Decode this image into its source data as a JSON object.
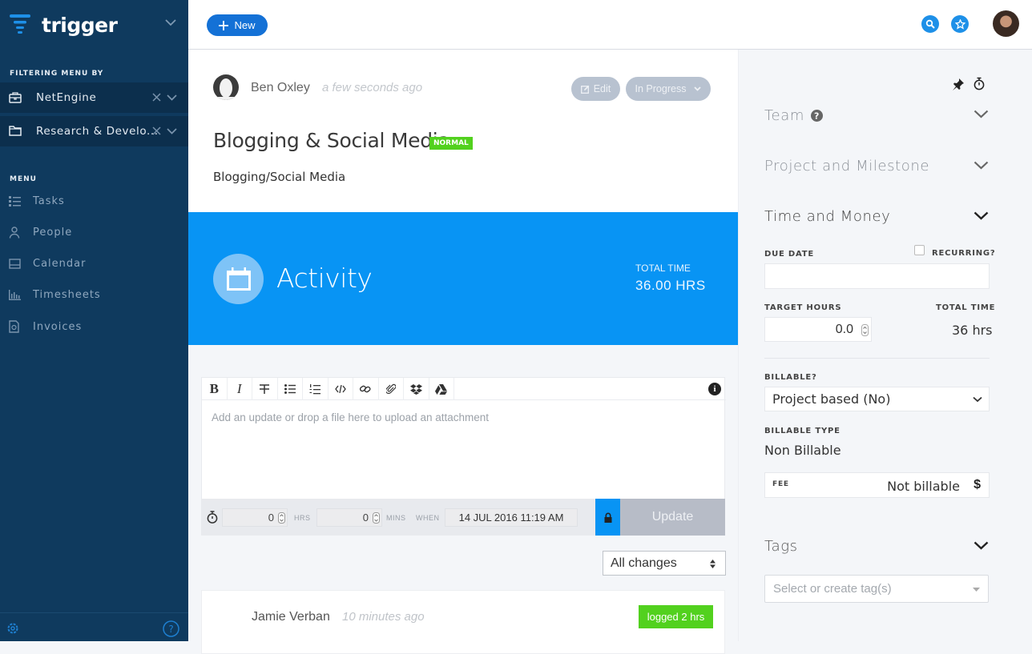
{
  "sidebar": {
    "brand": "trigger",
    "filter_heading": "FILTERING MENU BY",
    "filters": [
      {
        "icon": "briefcase-icon",
        "label": "NetEngine"
      },
      {
        "icon": "folder-icon",
        "label": "Research & Develo..."
      }
    ],
    "menu_heading": "MENU",
    "menu": [
      {
        "icon": "list-icon",
        "label": "Tasks"
      },
      {
        "icon": "person-icon",
        "label": "People"
      },
      {
        "icon": "calendar-icon",
        "label": "Calendar"
      },
      {
        "icon": "bar-chart-icon",
        "label": "Timesheets"
      },
      {
        "icon": "invoice-icon",
        "label": "Invoices"
      }
    ]
  },
  "topbar": {
    "new_label": "New"
  },
  "task": {
    "author": "Ben Oxley",
    "time_ago": "a few seconds ago",
    "edit_label": "Edit",
    "status": "In Progress",
    "title": "Blogging & Social Media",
    "priority": "NORMAL",
    "description": "Blogging/Social Media"
  },
  "activity": {
    "title": "Activity",
    "total_time_label": "TOTAL TIME",
    "total_time_value": "36.00 HRS"
  },
  "editor": {
    "toolbar": [
      "bold",
      "italic",
      "strikethrough",
      "bullet-list",
      "numbered-list",
      "code",
      "link",
      "attachment",
      "dropbox",
      "google-drive"
    ],
    "placeholder": "Add an update or drop a file here to upload an attachment",
    "hours": "0",
    "hours_label": "HRS",
    "mins": "0",
    "mins_label": "MINS",
    "when_label": "WHEN",
    "when_value": "14 JUL 2016 11:19 AM",
    "update_label": "Update"
  },
  "feed": {
    "filter": "All changes",
    "items": [
      {
        "author": "Jamie Verban",
        "time_ago": "10 minutes ago",
        "badge": "logged 2 hrs"
      }
    ]
  },
  "right_panel": {
    "sections": {
      "team": "Team",
      "project": "Project and Milestone",
      "time_money": "Time and Money",
      "tags": "Tags"
    },
    "due_date_label": "DUE DATE",
    "due_date_value": "",
    "recurring_label": "RECURRING?",
    "recurring_checked": false,
    "target_hours_label": "TARGET HOURS",
    "target_hours_value": "0.0",
    "total_time_label": "TOTAL TIME",
    "total_time_value": "36 hrs",
    "billable_label": "BILLABLE?",
    "billable_value": "Project based (No)",
    "billable_type_label": "BILLABLE TYPE",
    "billable_type_value": "Non Billable",
    "fee_label": "FEE",
    "fee_value": "Not billable",
    "fee_currency": "$",
    "tags_placeholder": "Select or create tag(s)"
  },
  "colors": {
    "sidebar_bg": "#0f3a5e",
    "accent_blue": "#0894f4",
    "new_button": "#1471d6",
    "green_badge": "#52d11e"
  }
}
